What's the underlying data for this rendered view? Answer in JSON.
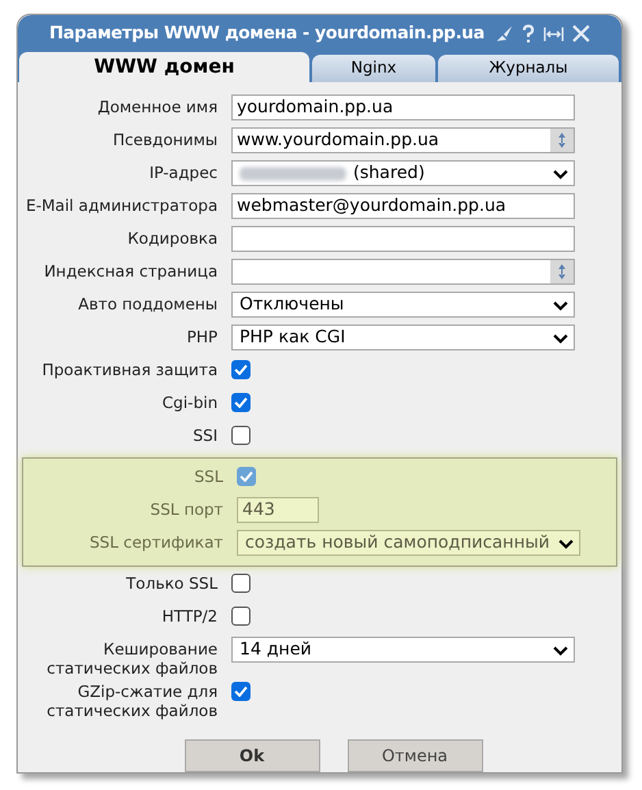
{
  "window": {
    "title": "Параметры WWW домена - yourdomain.pp.ua"
  },
  "tabs": [
    {
      "label": "WWW домен",
      "selected": true
    },
    {
      "label": "Nginx",
      "selected": false
    },
    {
      "label": "Журналы",
      "selected": false
    }
  ],
  "fields": [
    {
      "kind": "text",
      "label": "Доменное имя",
      "value": "yourdomain.pp.ua"
    },
    {
      "kind": "combo",
      "label": "Псевдонимы",
      "value": "www.yourdomain.pp.ua"
    },
    {
      "kind": "select",
      "label": "IP-адрес",
      "value": "(shared)",
      "blurred_prefix": true
    },
    {
      "kind": "text",
      "label": "E-Mail администратора",
      "value": "webmaster@yourdomain.pp.ua"
    },
    {
      "kind": "text",
      "label": "Кодировка"
    },
    {
      "kind": "combo",
      "label": "Индексная страница"
    },
    {
      "kind": "select",
      "label": "Авто поддомены",
      "value": "Отключены"
    },
    {
      "kind": "select",
      "label": "PHP",
      "value": "PHP как CGI"
    },
    {
      "kind": "checkbox",
      "label": "Проактивная защита",
      "checked": true
    },
    {
      "kind": "checkbox",
      "label": "Cgi-bin",
      "checked": true
    },
    {
      "kind": "checkbox",
      "label": "SSI",
      "checked": false
    }
  ],
  "highlighted_section": {
    "fields": [
      {
        "kind": "checkbox",
        "label": "SSL",
        "checked": true,
        "disabled": true
      },
      {
        "kind": "short",
        "label": "SSL порт",
        "value": "443",
        "disabled": true
      },
      {
        "kind": "select",
        "label": "SSL сертификат",
        "value": "создать новый самоподписанный",
        "disabled": true
      }
    ]
  },
  "more_fields": [
    {
      "kind": "checkbox",
      "label": "Только SSL",
      "checked": false
    },
    {
      "kind": "checkbox",
      "label": "HTTP/2",
      "checked": false
    },
    {
      "kind": "select",
      "label": "Кеширование статических файлов",
      "value": "14 дней"
    },
    {
      "kind": "checkbox",
      "label": "GZip-сжатие для статических файлов",
      "checked": true
    }
  ],
  "buttons": [
    {
      "label": "Ok",
      "primary": true
    },
    {
      "label": "Отмена",
      "primary": false
    }
  ]
}
